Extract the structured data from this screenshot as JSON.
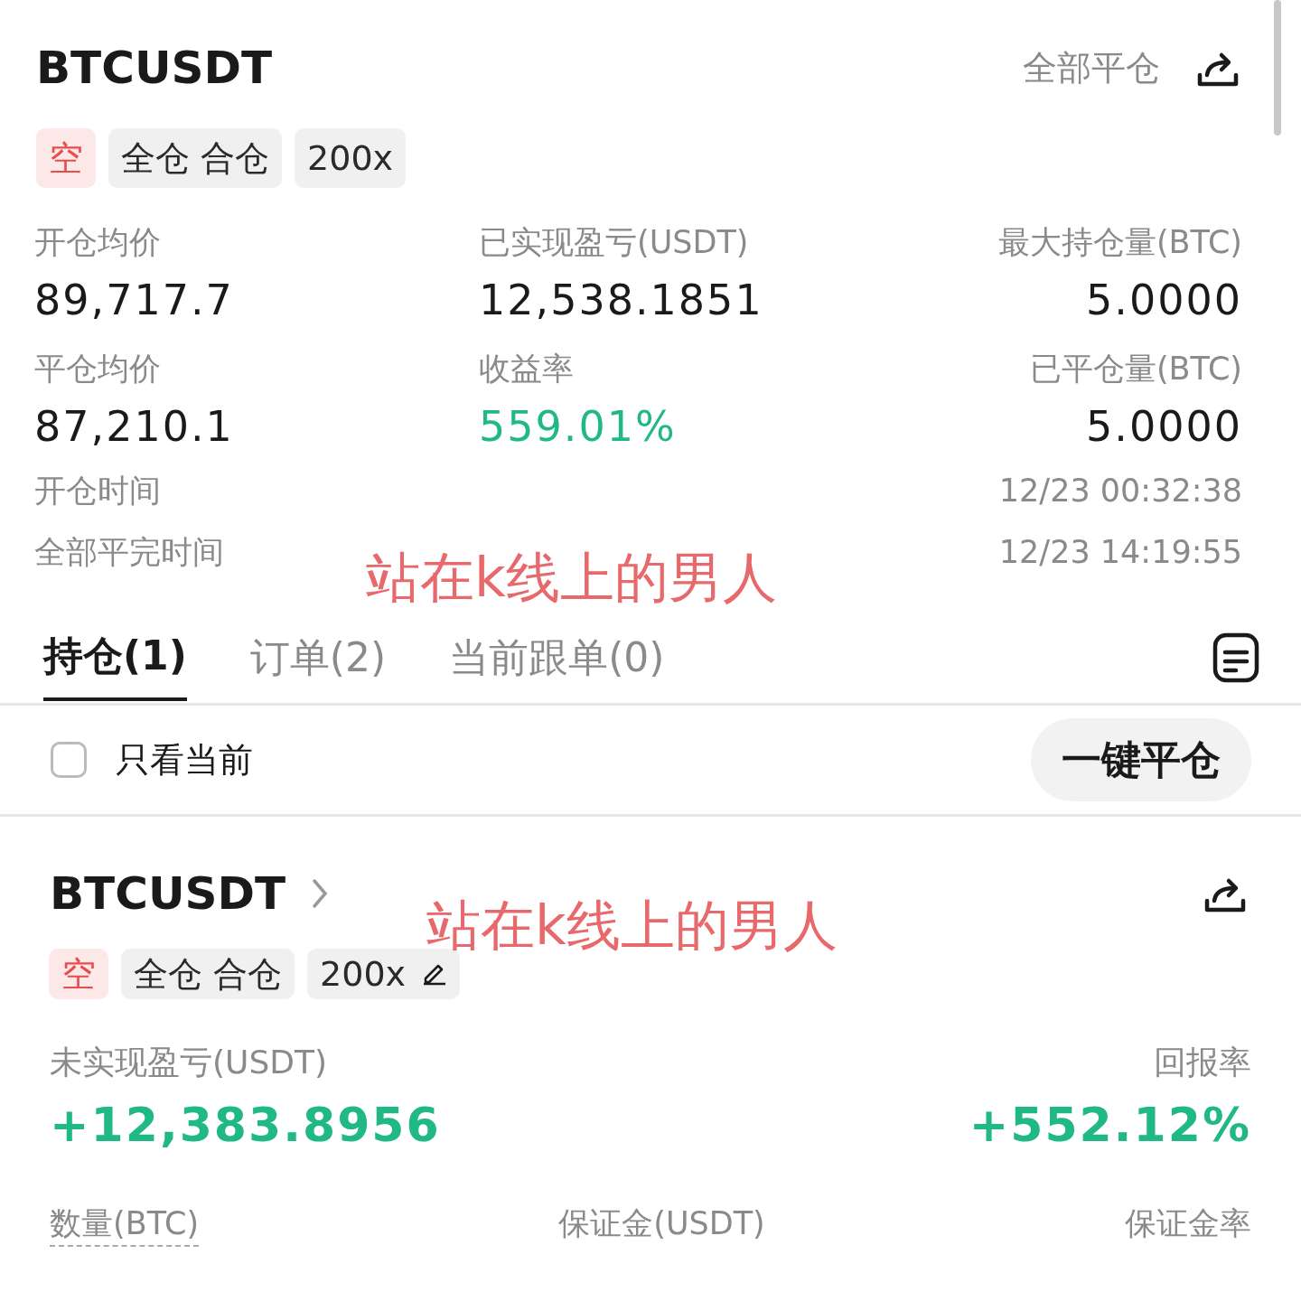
{
  "header": {
    "symbol": "BTCUSDT",
    "close_all": "全部平仓"
  },
  "tags": [
    {
      "text": "空",
      "kind": "side"
    },
    {
      "text": "全仓 合仓",
      "kind": "mode"
    },
    {
      "text": "200x",
      "kind": "leverage",
      "editable": false
    }
  ],
  "stats": [
    {
      "label": "开仓均价",
      "value": "89,717.7",
      "kind": "plain"
    },
    {
      "label": "已实现盈亏(USDT)",
      "value": "12,538.1851",
      "kind": "plain"
    },
    {
      "label": "最大持仓量(BTC)",
      "value": "5.0000",
      "kind": "plain"
    },
    {
      "label": "平仓均价",
      "value": "87,210.1",
      "kind": "plain"
    },
    {
      "label": "收益率",
      "value": "559.01%",
      "kind": "profit"
    },
    {
      "label": "已平仓量(BTC)",
      "value": "5.0000",
      "kind": "plain"
    }
  ],
  "times": [
    {
      "label": "开仓时间",
      "value": "12/23 00:32:38"
    },
    {
      "label": "全部平完时间",
      "value": "12/23 14:19:55"
    }
  ],
  "tabs": [
    {
      "label": "持仓(1)",
      "selected": true
    },
    {
      "label": "订单(2)",
      "selected": false
    },
    {
      "label": "当前跟单(0)",
      "selected": false
    }
  ],
  "filter": {
    "label": "只看当前",
    "checked": false
  },
  "close_button": "一键平仓",
  "position": {
    "symbol": "BTCUSDT",
    "tags": [
      {
        "text": "空",
        "kind": "side"
      },
      {
        "text": "全仓 合仓",
        "kind": "mode"
      },
      {
        "text": "200x",
        "kind": "leverage",
        "editable": true
      }
    ],
    "pnl_label": "未实现盈亏(USDT)",
    "pnl_value": "+12,383.8956",
    "roe_label": "回报率",
    "roe_value": "+552.12%",
    "columns": [
      "数量(BTC)",
      "保证金(USDT)",
      "保证金率"
    ]
  },
  "overlay_notes": [
    "站在k线上的男人",
    "站在k线上的男人"
  ]
}
